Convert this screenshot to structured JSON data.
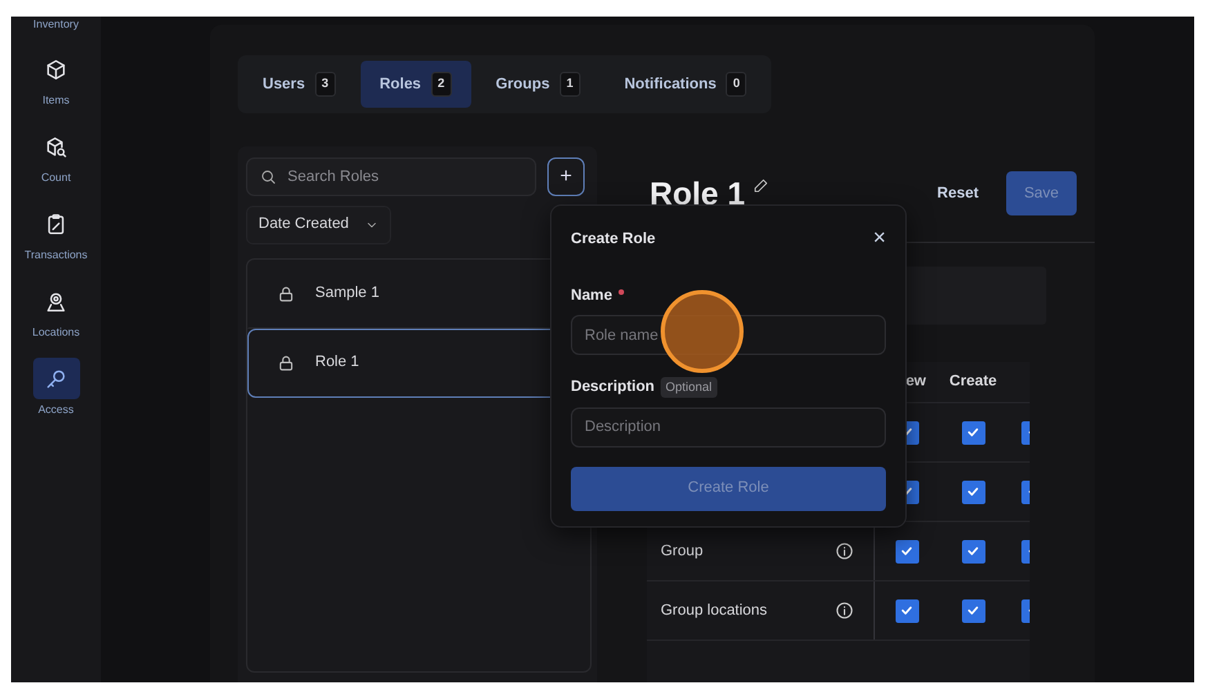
{
  "sidebar": {
    "top_label": "Inventory",
    "items": [
      {
        "label": "Items",
        "selected": false
      },
      {
        "label": "Count",
        "selected": false
      },
      {
        "label": "Transactions",
        "selected": false
      },
      {
        "label": "Locations",
        "selected": false
      },
      {
        "label": "Access",
        "selected": true
      }
    ]
  },
  "tabs": [
    {
      "label": "Users",
      "count": "3",
      "selected": false
    },
    {
      "label": "Roles",
      "count": "2",
      "selected": true
    },
    {
      "label": "Groups",
      "count": "1",
      "selected": false
    },
    {
      "label": "Notifications",
      "count": "0",
      "selected": false
    }
  ],
  "roles_panel": {
    "search": {
      "placeholder": "Search Roles"
    },
    "add_button": "+",
    "sort": "Date Created",
    "roles": [
      {
        "name": "Sample 1",
        "selected": false
      },
      {
        "name": "Role 1",
        "selected": true
      }
    ]
  },
  "detail": {
    "title": "Role 1",
    "reset": {
      "label": "Reset",
      "disabled": false
    },
    "save": {
      "label": "Save",
      "disabled": true
    },
    "table": {
      "columns": [
        "ew",
        "Create"
      ],
      "rows": [
        {
          "checked": [
            true,
            true,
            true
          ]
        },
        {
          "checked": [
            true,
            true,
            true
          ]
        },
        {
          "name": "Group",
          "checked": [
            true,
            true,
            true
          ]
        },
        {
          "name": "Group locations",
          "checked": [
            true,
            true,
            true
          ]
        }
      ]
    }
  },
  "modal": {
    "title": "Create Role",
    "close": "×",
    "name_label": "Name",
    "required": true,
    "name_placeholder": "Role name",
    "description_label": "Description",
    "optional_badge": "Optional",
    "description_placeholder": "Description",
    "submit": {
      "label": "Create Role",
      "disabled": true
    }
  }
}
